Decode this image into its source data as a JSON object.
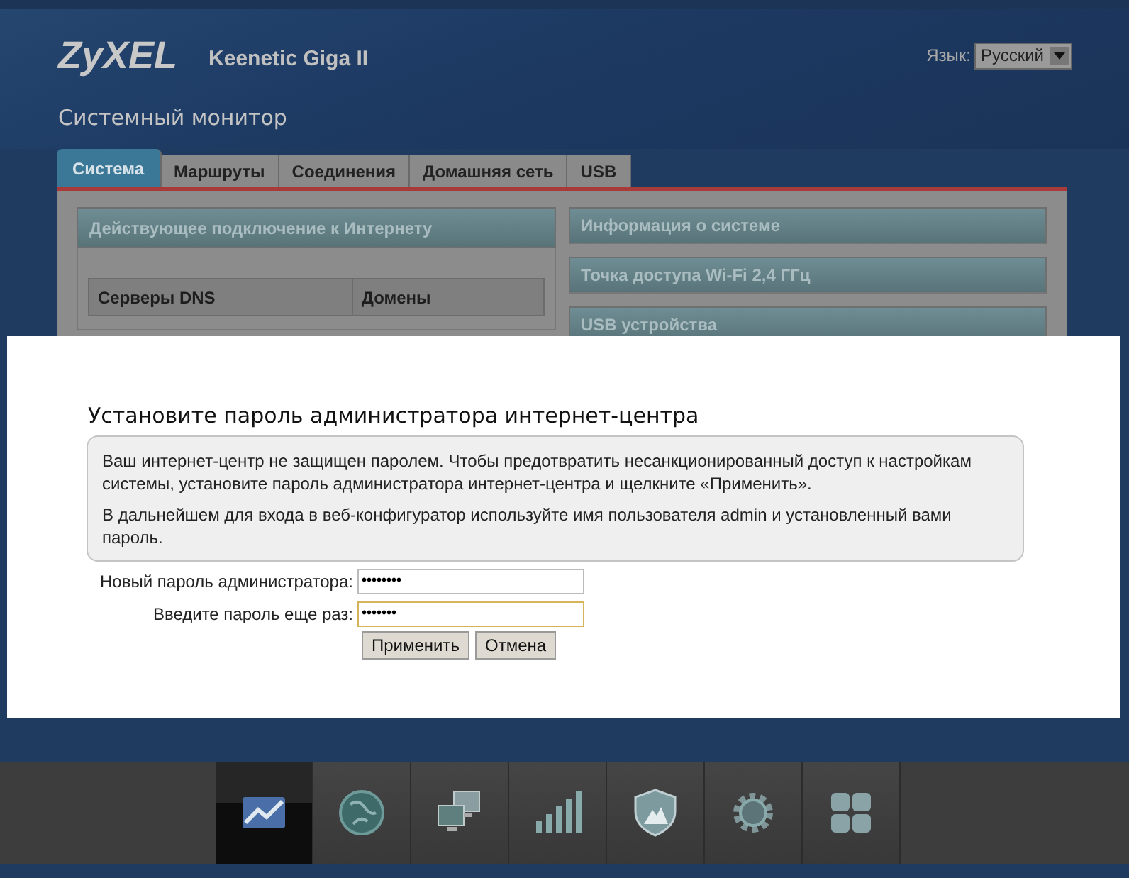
{
  "header": {
    "logo": "ZyXEL",
    "model": "Keenetic Giga II",
    "language_label": "Язык:",
    "language_value": "Русский"
  },
  "page_title": "Системный монитор",
  "tabs": [
    {
      "label": "Система",
      "selected": true
    },
    {
      "label": "Маршруты",
      "selected": false
    },
    {
      "label": "Соединения",
      "selected": false
    },
    {
      "label": "Домашняя сеть",
      "selected": false
    },
    {
      "label": "USB",
      "selected": false
    }
  ],
  "left_panel": {
    "title": "Действующее подключение к Интернету",
    "columns": [
      "Серверы DNS",
      "Домены"
    ]
  },
  "right_panels": [
    {
      "title": "Информация о системе"
    },
    {
      "title": "Точка доступа Wi-Fi 2,4 ГГц"
    },
    {
      "title": "USB устройства"
    }
  ],
  "dialog": {
    "title": "Установите пароль администратора интернет-центра",
    "paragraphs": [
      "Ваш интернет-центр не защищен паролем. Чтобы предотвратить несанкционированный доступ к настройкам системы, установите пароль администратора интернет-центра и щелкните «Применить».",
      "В дальнейшем для входа в веб-конфигуратор используйте имя пользователя admin и установленный вами пароль."
    ],
    "fields": [
      {
        "label": "Новый пароль администратора:",
        "value": "••••••••",
        "focused": false
      },
      {
        "label": "Введите пароль еще раз:",
        "value": "•••••••",
        "focused": true
      }
    ],
    "buttons": [
      "Применить",
      "Отмена"
    ]
  },
  "taskbar": [
    {
      "kind": "chart",
      "selected": true
    },
    {
      "kind": "globe",
      "selected": false
    },
    {
      "kind": "computers",
      "selected": false
    },
    {
      "kind": "signal",
      "selected": false
    },
    {
      "kind": "shield",
      "selected": false
    },
    {
      "kind": "gear",
      "selected": false
    },
    {
      "kind": "grid",
      "selected": false
    }
  ]
}
